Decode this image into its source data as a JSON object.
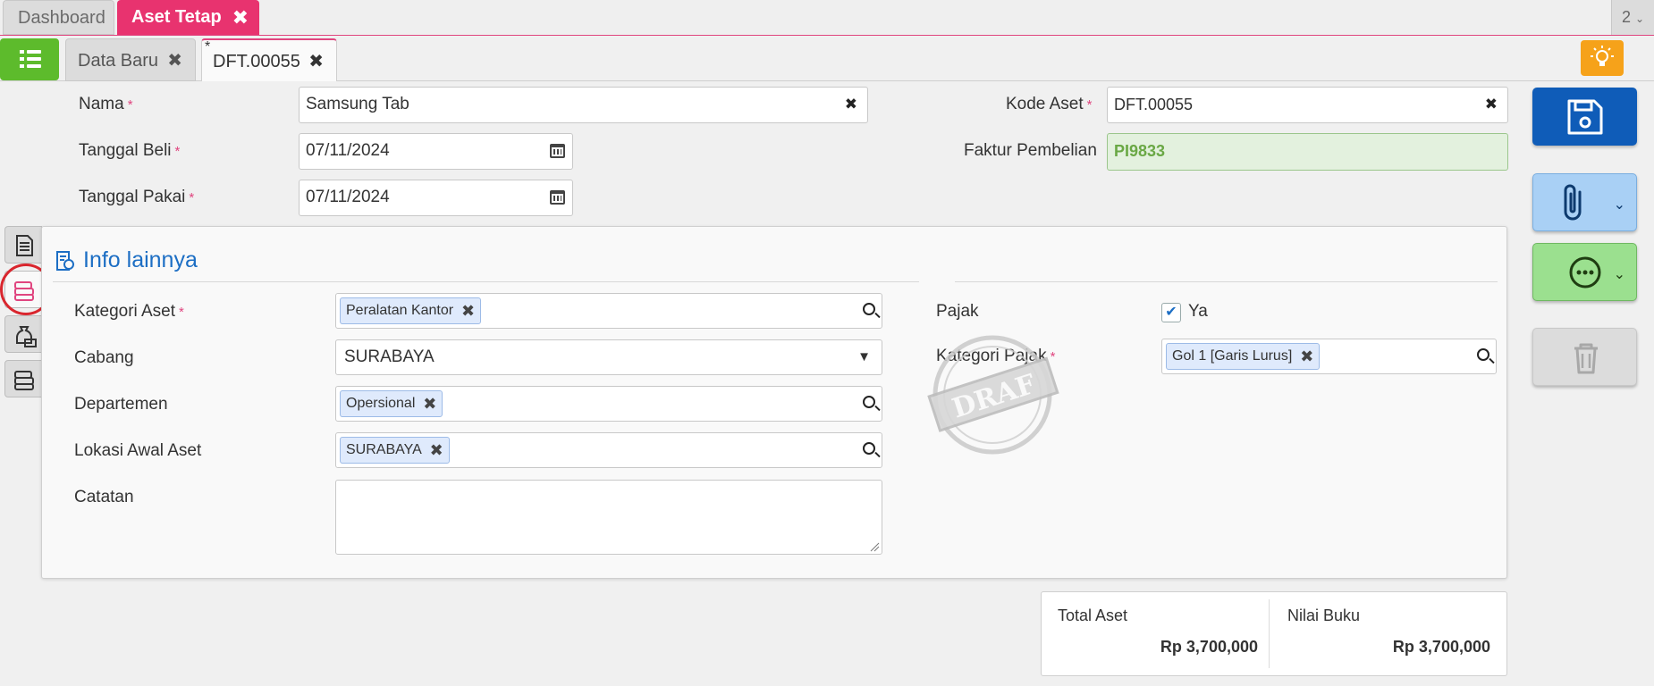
{
  "app_tabs": [
    {
      "label": "Dashboard"
    },
    {
      "label": "Aset Tetap"
    }
  ],
  "top_right_indicator": "2",
  "doc_tabs": [
    {
      "label": "Data Baru"
    },
    {
      "label": "DFT.00055",
      "modified_marker": "*"
    }
  ],
  "form": {
    "nama": {
      "label": "Nama",
      "value": "Samsung Tab"
    },
    "tanggal_beli": {
      "label": "Tanggal Beli",
      "value": "07/11/2024"
    },
    "tanggal_pakai": {
      "label": "Tanggal Pakai",
      "value": "07/11/2024"
    },
    "kode_aset": {
      "label": "Kode Aset",
      "value": "DFT.00055"
    },
    "faktur_pembelian": {
      "label": "Faktur Pembelian",
      "value": "PI9833"
    },
    "required_mark": "*"
  },
  "panel": {
    "title": "Info lainnya",
    "kategori_aset": {
      "label": "Kategori Aset",
      "chip": "Peralatan Kantor"
    },
    "cabang": {
      "label": "Cabang",
      "value": "SURABAYA"
    },
    "departemen": {
      "label": "Departemen",
      "chip": "Opersional"
    },
    "lokasi_awal": {
      "label": "Lokasi Awal Aset",
      "chip": "SURABAYA"
    },
    "catatan": {
      "label": "Catatan",
      "value": ""
    },
    "pajak": {
      "label": "Pajak",
      "checkbox_label": "Ya",
      "checked": true
    },
    "kategori_pajak": {
      "label": "Kategori Pajak",
      "chip": "Gol 1 [Garis Lurus]"
    },
    "stamp_text": "DRAF"
  },
  "totals": {
    "total_aset": {
      "label": "Total Aset",
      "value": "Rp 3,700,000"
    },
    "nilai_buku": {
      "label": "Nilai Buku",
      "value": "Rp 3,700,000"
    }
  },
  "colors": {
    "accent_pink": "#e8336f",
    "menu_green": "#5dbb2c",
    "save_blue": "#0f5cb8",
    "title_blue": "#1c6ec4",
    "bulb_orange": "#f6a21a"
  },
  "icons": {
    "menu": "list-icon",
    "bulb": "lightbulb-icon",
    "save": "floppy-disk-icon",
    "attach": "paperclip-icon",
    "more": "more-dots-icon",
    "delete": "trash-icon"
  }
}
